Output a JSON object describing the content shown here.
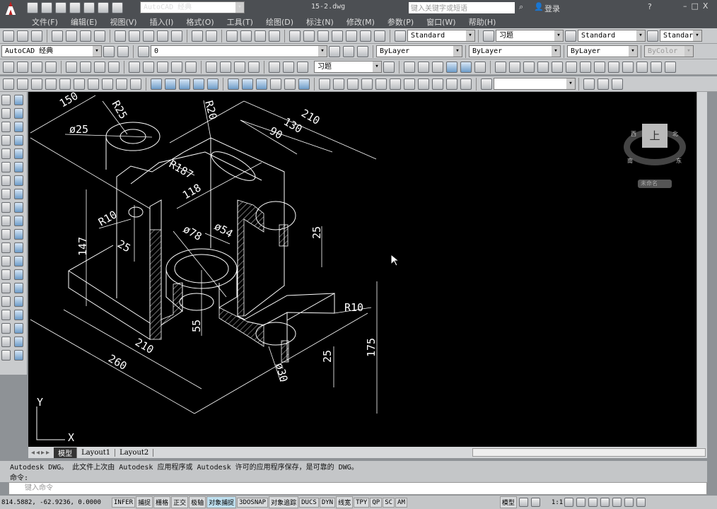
{
  "title_bar": {
    "workspace": "AutoCAD 经典",
    "filename": "15-2.dwg",
    "search_placeholder": "键入关键字或短语",
    "login": "登录"
  },
  "menu": [
    "文件(F)",
    "编辑(E)",
    "视图(V)",
    "插入(I)",
    "格式(O)",
    "工具(T)",
    "绘图(D)",
    "标注(N)",
    "修改(M)",
    "参数(P)",
    "窗口(W)",
    "帮助(H)"
  ],
  "toolbars": {
    "text_style": "Standard",
    "dim_style": "习题",
    "table_style": "Standard",
    "mleader_style": "Standar",
    "workspace": "AutoCAD 经典",
    "layer": "0",
    "color": "ByLayer",
    "linetype": "ByLayer",
    "lineweight": "ByLayer",
    "plotstyle": "ByColor",
    "dim_style2": "习题"
  },
  "viewcube": {
    "face": "上",
    "north": "北",
    "east": "东",
    "south": "南",
    "west": "西",
    "wcs": "未命名"
  },
  "drawing": {
    "dims": [
      "150",
      "R25",
      "ø25",
      "R20",
      "210",
      "130",
      "90",
      "R187",
      "118",
      "R10",
      "147",
      "25",
      "ø78",
      "ø54",
      "25",
      "55",
      "210",
      "260",
      "R10",
      "175",
      "25",
      "ø30"
    ],
    "ucs_y": "Y",
    "ucs_x": "X"
  },
  "tabs": [
    "模型",
    "Layout1",
    "Layout2"
  ],
  "command": {
    "history1": "Autodesk DWG。  此文件上次由 Autodesk 应用程序或 Autodesk 许可的应用程序保存，是可靠的 DWG。",
    "history2": "命令:",
    "placeholder": "键入命令"
  },
  "status": {
    "coords": "814.5882, -62.9236, 0.0000",
    "toggles": [
      "INFER",
      "捕捉",
      "栅格",
      "正交",
      "极轴",
      "对象捕捉",
      "3DOSNAP",
      "对象追踪",
      "DUCS",
      "DYN",
      "线宽",
      "TPY",
      "QP",
      "SC",
      "AM"
    ],
    "active": "对象捕捉",
    "model": "模型",
    "scale": "1:1"
  }
}
